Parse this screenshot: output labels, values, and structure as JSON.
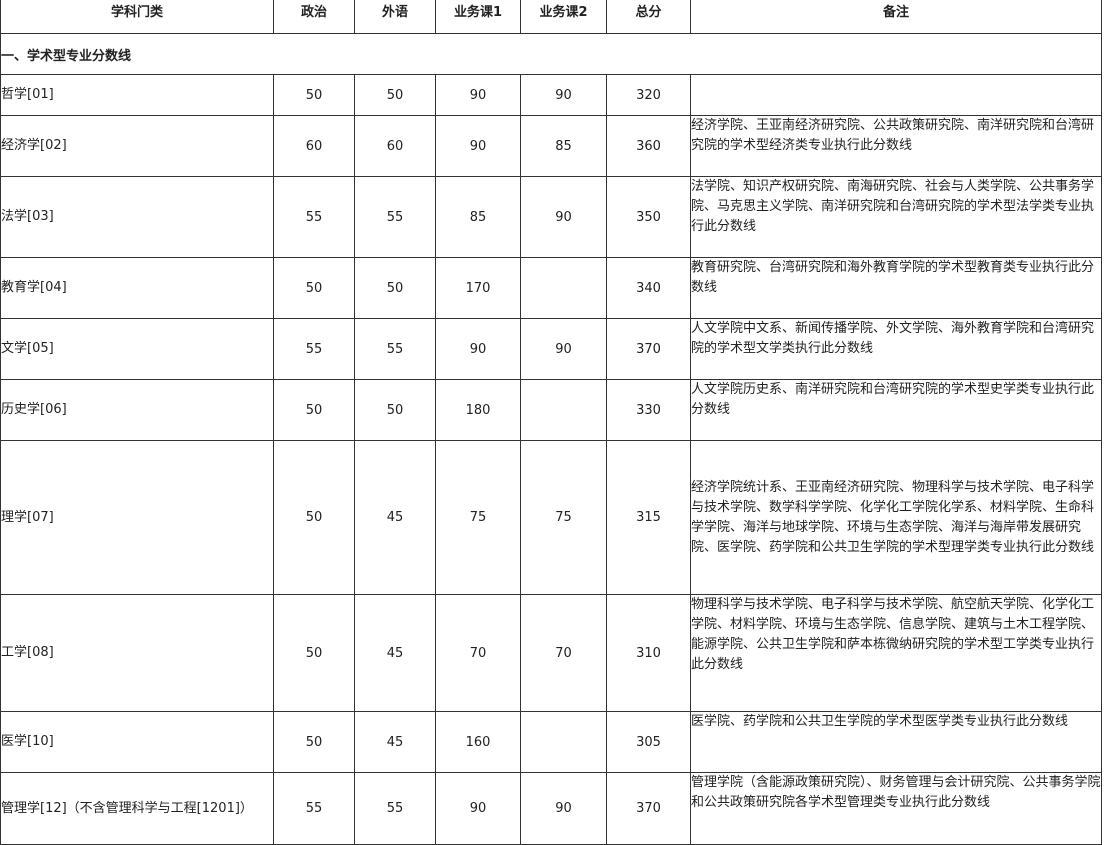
{
  "header": {
    "subject": "学科门类",
    "politics": "政治",
    "language": "外语",
    "course1": "业务课1",
    "course2": "业务课2",
    "total": "总分",
    "note": "备注"
  },
  "section_title": "一、学术型专业分数线",
  "rows": [
    {
      "subject": "哲学[01]",
      "politics": "50",
      "language": "50",
      "course1": "90",
      "course2": "90",
      "total": "320",
      "note": ""
    },
    {
      "subject": "经济学[02]",
      "politics": "60",
      "language": "60",
      "course1": "90",
      "course2": "85",
      "total": "360",
      "note": "经济学院、王亚南经济研究院、公共政策研究院、南洋研究院和台湾研究院的学术型经济类专业执行此分数线"
    },
    {
      "subject": "法学[03]",
      "politics": "55",
      "language": "55",
      "course1": "85",
      "course2": "90",
      "total": "350",
      "note": "法学院、知识产权研究院、南海研究院、社会与人类学院、公共事务学院、马克思主义学院、南洋研究院和台湾研究院的学术型法学类专业执行此分数线"
    },
    {
      "subject": "教育学[04]",
      "politics": "50",
      "language": "50",
      "course1": "170",
      "course2": "",
      "total": "340",
      "note": "教育研究院、台湾研究院和海外教育学院的学术型教育类专业执行此分数线"
    },
    {
      "subject": "文学[05]",
      "politics": "55",
      "language": "55",
      "course1": "90",
      "course2": "90",
      "total": "370",
      "note": "人文学院中文系、新闻传播学院、外文学院、海外教育学院和台湾研究院的学术型文学类执行此分数线"
    },
    {
      "subject": "历史学[06]",
      "politics": "50",
      "language": "50",
      "course1": "180",
      "course2": "",
      "total": "330",
      "note": "人文学院历史系、南洋研究院和台湾研究院的学术型史学类专业执行此分数线"
    },
    {
      "subject": "理学[07]",
      "politics": "50",
      "language": "45",
      "course1": "75",
      "course2": "75",
      "total": "315",
      "note": "经济学院统计系、王亚南经济研究院、物理科学与技术学院、电子科学与技术学院、数学科学学院、化学化工学院化学系、材料学院、生命科学学院、海洋与地球学院、环境与生态学院、海洋与海岸带发展研究院、医学院、药学院和公共卫生学院的学术型理学类专业执行此分数线"
    },
    {
      "subject": "工学[08]",
      "politics": "50",
      "language": "45",
      "course1": "70",
      "course2": "70",
      "total": "310",
      "note": "物理科学与技术学院、电子科学与技术学院、航空航天学院、化学化工学院、材料学院、环境与生态学院、信息学院、建筑与土木工程学院、能源学院、公共卫生学院和萨本栋微纳研究院的学术型工学类专业执行此分数线"
    },
    {
      "subject": "医学[10]",
      "politics": "50",
      "language": "45",
      "course1": "160",
      "course2": "",
      "total": "305",
      "note": "医学院、药学院和公共卫生学院的学术型医学类专业执行此分数线"
    },
    {
      "subject": "管理学[12]（不含管理科学与工程[1201]）",
      "politics": "55",
      "language": "55",
      "course1": "90",
      "course2": "90",
      "total": "370",
      "note": "管理学院（含能源政策研究院）、财务管理与会计研究院、公共事务学院和公共政策研究院各学术型管理类专业执行此分数线"
    }
  ]
}
